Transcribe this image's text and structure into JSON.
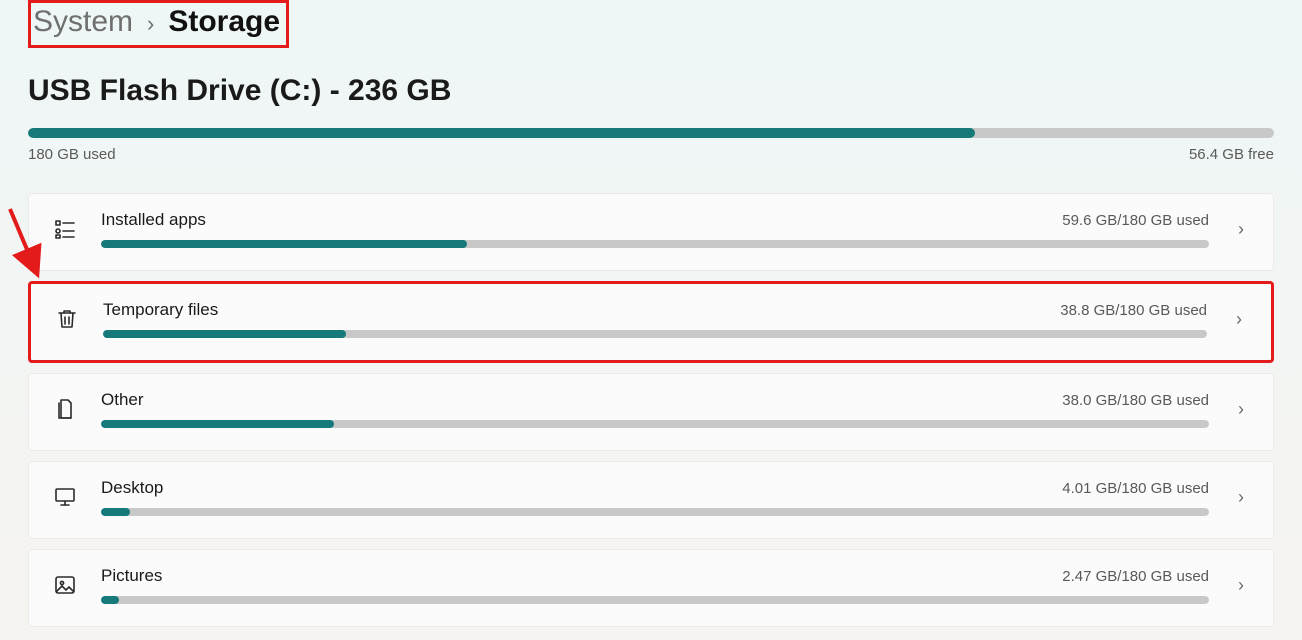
{
  "breadcrumb": {
    "parent": "System",
    "separator": "›",
    "current": "Storage"
  },
  "drive": {
    "title": "USB Flash Drive (C:) - 236 GB",
    "used_label": "180 GB used",
    "free_label": "56.4 GB free",
    "fill_percent": 76
  },
  "categories": [
    {
      "id": "installed-apps",
      "icon": "apps-icon",
      "name": "Installed apps",
      "used": "59.6 GB/180 GB used",
      "fill_percent": 33,
      "highlight": false
    },
    {
      "id": "temporary-files",
      "icon": "trash-icon",
      "name": "Temporary files",
      "used": "38.8 GB/180 GB used",
      "fill_percent": 22,
      "highlight": true
    },
    {
      "id": "other",
      "icon": "document-icon",
      "name": "Other",
      "used": "38.0 GB/180 GB used",
      "fill_percent": 21,
      "highlight": false
    },
    {
      "id": "desktop",
      "icon": "monitor-icon",
      "name": "Desktop",
      "used": "4.01 GB/180 GB used",
      "fill_percent": 2.6,
      "highlight": false
    },
    {
      "id": "pictures",
      "icon": "image-icon",
      "name": "Pictures",
      "used": "2.47 GB/180 GB used",
      "fill_percent": 1.6,
      "highlight": false
    }
  ],
  "colors": {
    "accent": "#167a7a",
    "highlight": "#e31b1b"
  }
}
